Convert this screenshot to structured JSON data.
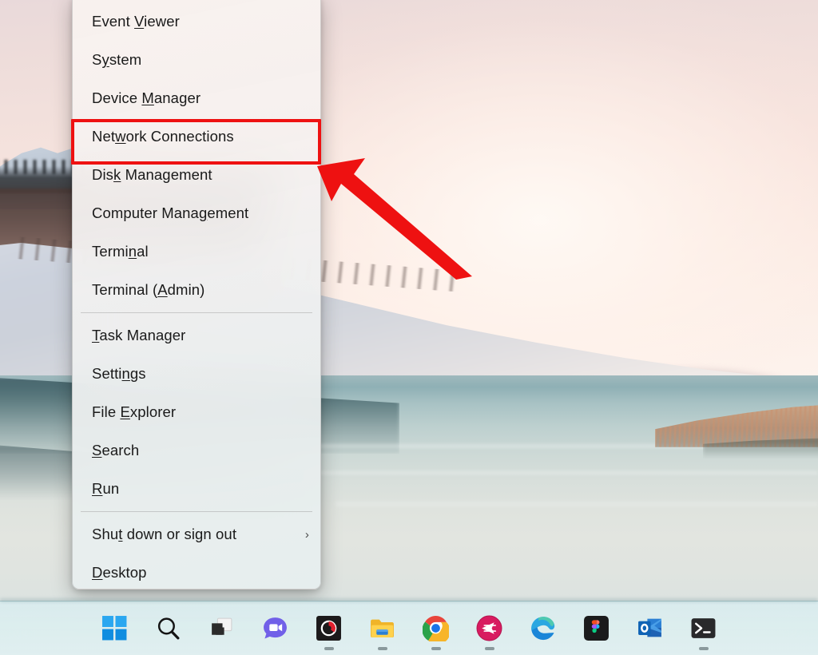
{
  "desktop": {
    "wallpaper_description": "Calm lake at dusk with pale pink sky, snowy shoreline, evergreen trees and golden reeds",
    "accent_red": "#ee1111",
    "taskbar_bg": "#dbeef0"
  },
  "winx_menu": {
    "name": "Windows Power User (Win+X) menu",
    "groups": [
      {
        "items": [
          {
            "label": "Event Viewer",
            "accel_index": 6,
            "has_submenu": false
          },
          {
            "label": "System",
            "accel_index": 1,
            "has_submenu": false
          },
          {
            "label": "Device Manager",
            "accel_index": 7,
            "has_submenu": false
          },
          {
            "label": "Network Connections",
            "accel_index": 3,
            "has_submenu": false,
            "highlighted": true
          },
          {
            "label": "Disk Management",
            "accel_index": 3,
            "has_submenu": false
          },
          {
            "label": "Computer Management",
            "accel_index": 13,
            "has_submenu": false
          },
          {
            "label": "Terminal",
            "accel_index": 5,
            "has_submenu": false
          },
          {
            "label": "Terminal (Admin)",
            "accel_index": 10,
            "has_submenu": false
          }
        ]
      },
      {
        "items": [
          {
            "label": "Task Manager",
            "accel_index": 0,
            "has_submenu": false
          },
          {
            "label": "Settings",
            "accel_index": 5,
            "has_submenu": false
          },
          {
            "label": "File Explorer",
            "accel_index": 5,
            "has_submenu": false
          },
          {
            "label": "Search",
            "accel_index": 0,
            "has_submenu": false
          },
          {
            "label": "Run",
            "accel_index": 0,
            "has_submenu": false
          }
        ]
      },
      {
        "items": [
          {
            "label": "Shut down or sign out",
            "accel_index": 3,
            "has_submenu": true,
            "submenu_glyph": "›"
          },
          {
            "label": "Desktop",
            "accel_index": 0,
            "has_submenu": false
          }
        ]
      }
    ]
  },
  "annotation": {
    "highlight_color": "#ee1111",
    "highlight_target": "Network Connections",
    "arrow": "red-arrow-pointing-up-left"
  },
  "taskbar": {
    "items": [
      {
        "name": "start-button",
        "label": "Start",
        "icon": "windows-logo-icon",
        "active": false
      },
      {
        "name": "search-button",
        "label": "Search",
        "icon": "search-icon",
        "active": false
      },
      {
        "name": "task-view-button",
        "label": "Task View",
        "icon": "task-view-icon",
        "active": false
      },
      {
        "name": "chat-button",
        "label": "Chat",
        "icon": "chat-video-icon",
        "active": false
      },
      {
        "name": "recorder-button",
        "label": "Screen Recorder",
        "icon": "recorder-icon",
        "active": true
      },
      {
        "name": "file-explorer-button",
        "label": "File Explorer",
        "icon": "folder-icon",
        "active": true
      },
      {
        "name": "chrome-button",
        "label": "Google Chrome",
        "icon": "chrome-icon",
        "active": true
      },
      {
        "name": "app-pink-button",
        "label": "Pinned App",
        "icon": "pink-arrow-icon",
        "active": true
      },
      {
        "name": "edge-button",
        "label": "Microsoft Edge",
        "icon": "edge-icon",
        "active": false
      },
      {
        "name": "figma-button",
        "label": "Figma",
        "icon": "figma-icon",
        "active": false
      },
      {
        "name": "outlook-button",
        "label": "Outlook",
        "icon": "outlook-icon",
        "active": false
      },
      {
        "name": "terminal-button",
        "label": "Terminal",
        "icon": "terminal-icon",
        "active": true
      }
    ]
  }
}
